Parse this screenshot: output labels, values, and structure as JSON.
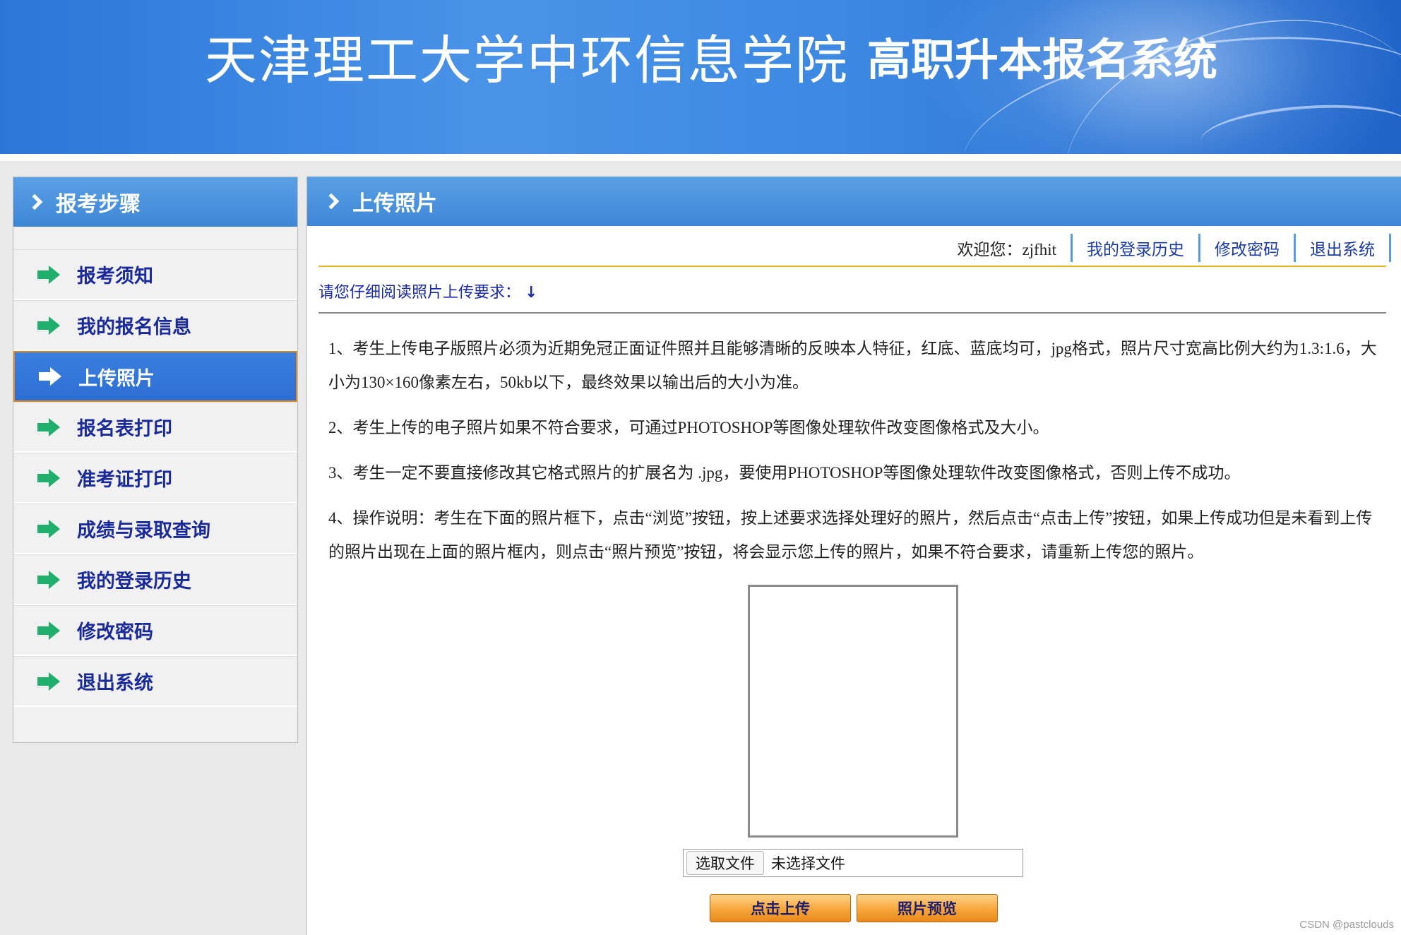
{
  "banner": {
    "title_main": "天津理工大学中环信息学院",
    "title_sub": "高职升本报名系统"
  },
  "sidebar": {
    "title": "报考步骤",
    "items": [
      {
        "label": "报考须知",
        "icon": "green-arrow-icon",
        "active": false
      },
      {
        "label": "我的报名信息",
        "icon": "green-arrow-icon",
        "active": false
      },
      {
        "label": "上传照片",
        "icon": "white-arrow-icon",
        "active": true
      },
      {
        "label": "报名表打印",
        "icon": "green-arrow-icon",
        "active": false
      },
      {
        "label": "准考证打印",
        "icon": "green-arrow-icon",
        "active": false
      },
      {
        "label": "成绩与录取查询",
        "icon": "green-arrow-icon",
        "active": false
      },
      {
        "label": "我的登录历史",
        "icon": "green-arrow-icon",
        "active": false
      },
      {
        "label": "修改密码",
        "icon": "green-arrow-icon",
        "active": false
      },
      {
        "label": "退出系统",
        "icon": "green-arrow-icon",
        "active": false
      }
    ]
  },
  "main": {
    "title": "上传照片",
    "userbar": {
      "welcome": "欢迎您：zjfhit",
      "links": [
        "我的登录历史",
        "修改密码",
        "退出系统"
      ]
    },
    "notice_title": "请您仔细阅读照片上传要求：",
    "notice_arrow": "↓",
    "rules": [
      "1、考生上传电子版照片必须为近期免冠正面证件照并且能够清晰的反映本人特征，红底、蓝底均可，jpg格式，照片尺寸宽高比例大约为1.3:1.6，大小为130×160像素左右，50kb以下，最终效果以输出后的大小为准。",
      "2、考生上传的电子照片如果不符合要求，可通过PHOTOSHOP等图像处理软件改变图像格式及大小。",
      "3、考生一定不要直接修改其它格式照片的扩展名为 .jpg，要使用PHOTOSHOP等图像处理软件改变图像格式，否则上传不成功。",
      "4、操作说明：考生在下面的照片框下，点击“浏览”按钮，按上述要求选择处理好的照片，然后点击“点击上传”按钮，如果上传成功但是未看到上传的照片出现在上面的照片框内，则点击“照片预览”按钮，将会显示您上传的照片，如果不符合要求，请重新上传您的照片。"
    ],
    "file_input": {
      "button_label": "选取文件",
      "status": "未选择文件"
    },
    "upload_button": "点击上传",
    "preview_button": "照片预览"
  },
  "watermark": "CSDN @pastclouds",
  "colors": {
    "header_blue": "#3f86d6",
    "link_blue": "#1a3aa8",
    "active_item": "#2d6ed3",
    "arrow_green": "#1fae6c",
    "button_orange": "#f6a53a"
  }
}
